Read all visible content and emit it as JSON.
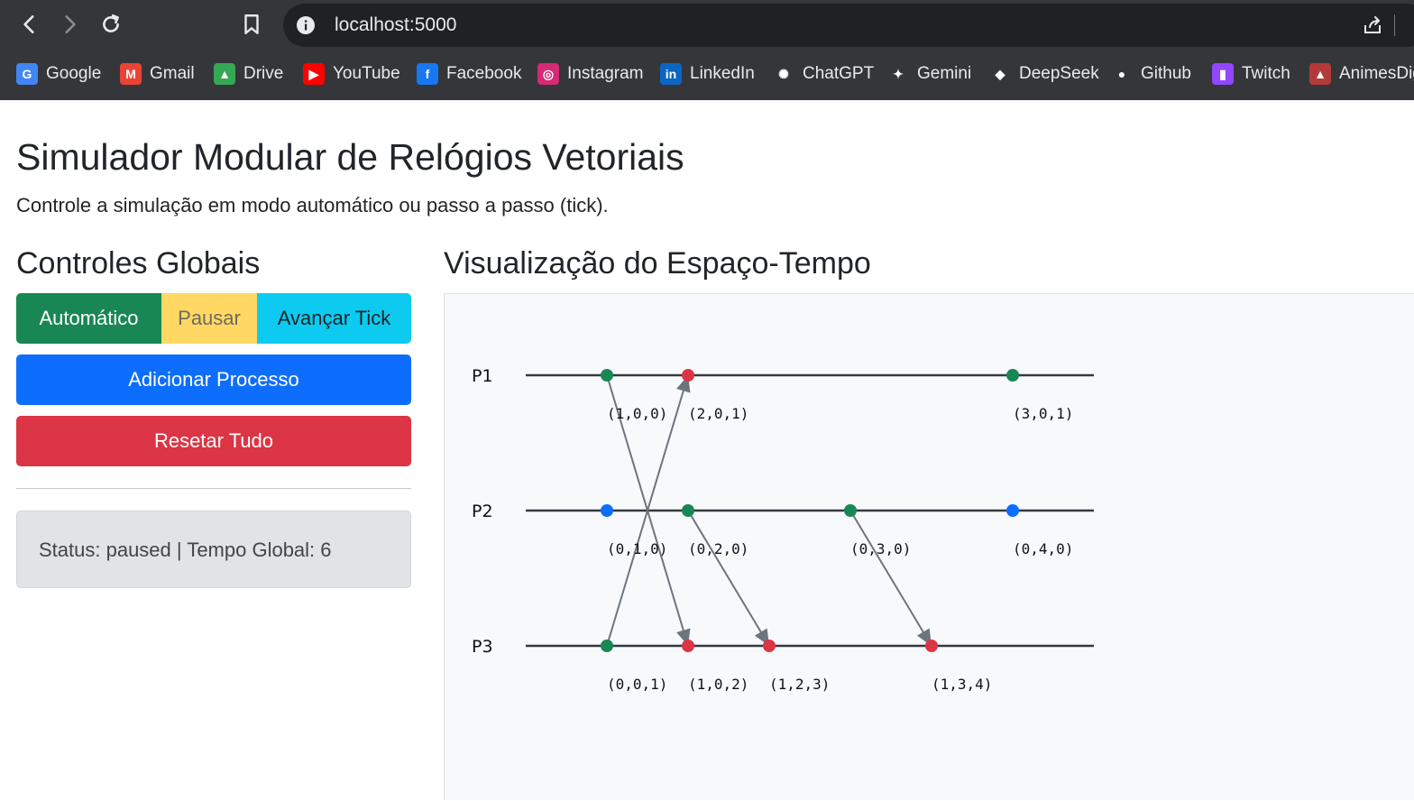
{
  "browser": {
    "url": "localhost:5000",
    "bookmarks": [
      {
        "label": "Google",
        "icon": "google-icon",
        "color": "#4285f4",
        "glyph": "G"
      },
      {
        "label": "Gmail",
        "icon": "gmail-icon",
        "color": "#ea4335",
        "glyph": "M"
      },
      {
        "label": "Drive",
        "icon": "drive-icon",
        "color": "#34a853",
        "glyph": "▲"
      },
      {
        "label": "YouTube",
        "icon": "youtube-icon",
        "color": "#ff0000",
        "glyph": "▶"
      },
      {
        "label": "Facebook",
        "icon": "facebook-icon",
        "color": "#1877f2",
        "glyph": "f"
      },
      {
        "label": "Instagram",
        "icon": "instagram-icon",
        "color": "#d62976",
        "glyph": "◎"
      },
      {
        "label": "LinkedIn",
        "icon": "linkedin-icon",
        "color": "#0a66c2",
        "glyph": "in"
      },
      {
        "label": "ChatGPT",
        "icon": "chatgpt-icon",
        "color": "#35363a",
        "glyph": "✺"
      },
      {
        "label": "Gemini",
        "icon": "gemini-icon",
        "color": "#35363a",
        "glyph": "✦"
      },
      {
        "label": "DeepSeek",
        "icon": "deepseek-icon",
        "color": "#35363a",
        "glyph": "◆"
      },
      {
        "label": "Github",
        "icon": "github-icon",
        "color": "#35363a",
        "glyph": "●"
      },
      {
        "label": "Twitch",
        "icon": "twitch-icon",
        "color": "#9146ff",
        "glyph": "▮"
      },
      {
        "label": "AnimesDig",
        "icon": "animesdigital-icon",
        "color": "#b23a3a",
        "glyph": "▲"
      }
    ]
  },
  "page": {
    "title": "Simulador Modular de Relógios Vetoriais",
    "subtitle": "Controle a simulação em modo automático ou passo a passo (tick).",
    "controls_heading": "Controles Globais",
    "viz_heading": "Visualização do Espaço-Tempo",
    "buttons": {
      "auto": "Automático",
      "pause": "Pausar",
      "tick": "Avançar Tick",
      "add": "Adicionar Processo",
      "reset": "Resetar Tudo"
    },
    "status": "Status: paused | Tempo Global: 6"
  },
  "diagram": {
    "colors": {
      "local": "#198754",
      "send": "#0d6efd",
      "recv": "#dc3545",
      "arrow": "#6c757d",
      "line": "#343a40"
    },
    "processes": [
      "P1",
      "P2",
      "P3"
    ],
    "events": [
      {
        "proc": 0,
        "t": 1,
        "type": "local",
        "label": "(1,0,0)"
      },
      {
        "proc": 0,
        "t": 2,
        "type": "recv",
        "label": "(2,0,1)"
      },
      {
        "proc": 0,
        "t": 6,
        "type": "local",
        "label": "(3,0,1)"
      },
      {
        "proc": 1,
        "t": 1,
        "type": "send",
        "label": "(0,1,0)"
      },
      {
        "proc": 1,
        "t": 2,
        "type": "local",
        "label": "(0,2,0)"
      },
      {
        "proc": 1,
        "t": 4,
        "type": "local",
        "label": "(0,3,0)"
      },
      {
        "proc": 1,
        "t": 6,
        "type": "send",
        "label": "(0,4,0)"
      },
      {
        "proc": 2,
        "t": 1,
        "type": "local",
        "label": "(0,0,1)"
      },
      {
        "proc": 2,
        "t": 2,
        "type": "recv",
        "label": "(1,0,2)"
      },
      {
        "proc": 2,
        "t": 3,
        "type": "recv",
        "label": "(1,2,3)"
      },
      {
        "proc": 2,
        "t": 5,
        "type": "recv",
        "label": "(1,3,4)"
      }
    ],
    "messages": [
      {
        "from": [
          0,
          1
        ],
        "to": [
          2,
          2
        ]
      },
      {
        "from": [
          2,
          1
        ],
        "to": [
          0,
          2
        ]
      },
      {
        "from": [
          1,
          2
        ],
        "to": [
          2,
          3
        ]
      },
      {
        "from": [
          1,
          4
        ],
        "to": [
          2,
          5
        ]
      }
    ]
  }
}
